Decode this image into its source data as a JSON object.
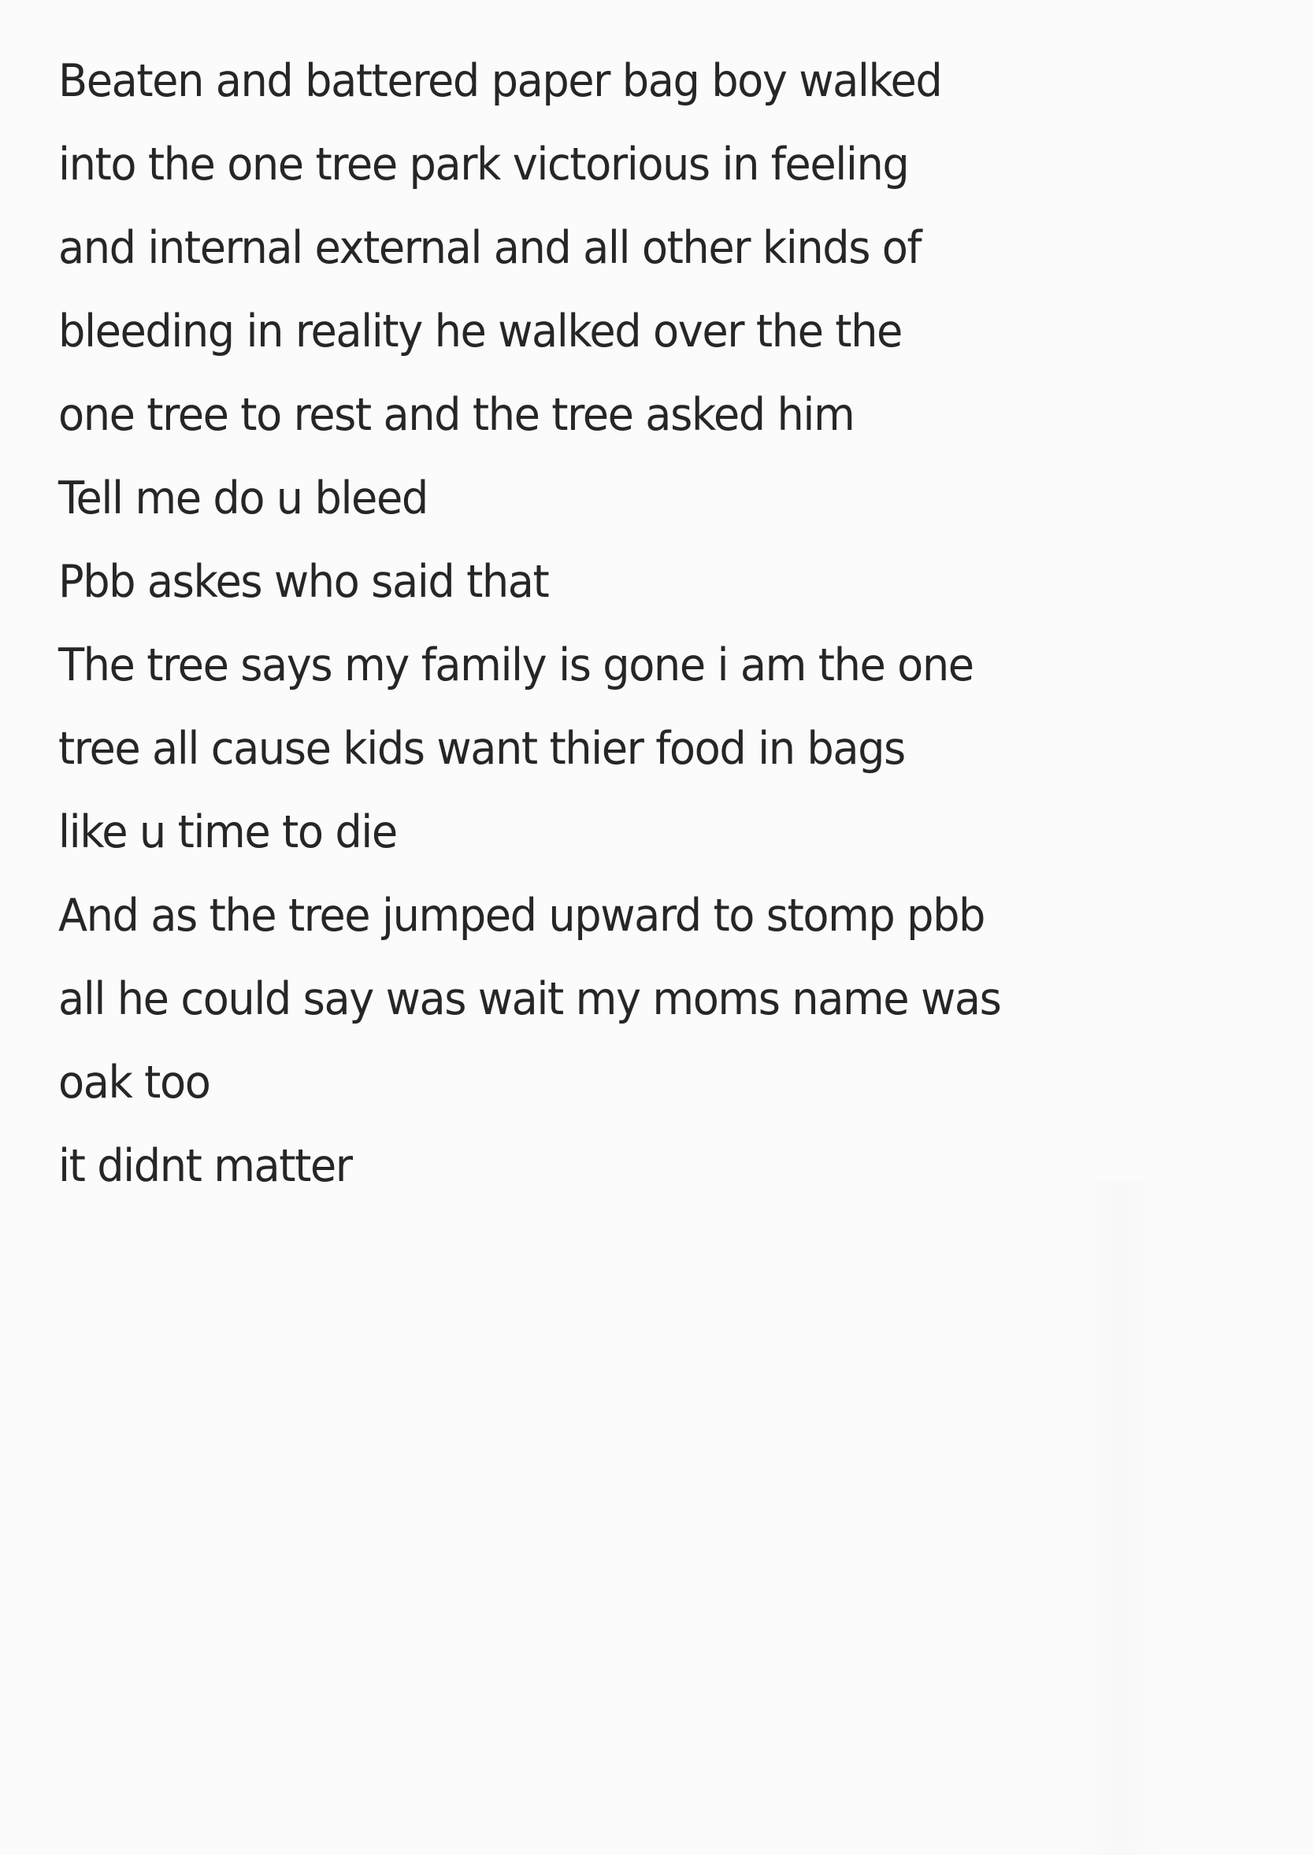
{
  "note": {
    "lines": [
      "Beaten and battered paper bag boy walked",
      "into the one tree park victorious in feeling",
      "and internal external and all other kinds of",
      "bleeding in reality he walked over the the",
      "one tree to rest and the tree asked him",
      "Tell me do u bleed",
      "Pbb askes who said that",
      "The tree says my family is gone i am the one",
      "tree all cause kids want thier food in bags",
      "like u time to die",
      "And as the tree jumped upward to stomp pbb",
      "all he could say was wait my moms name was",
      "oak too",
      "it didnt matter"
    ]
  },
  "colors": {
    "background": "#fbfbfb",
    "ink": "#262626"
  }
}
